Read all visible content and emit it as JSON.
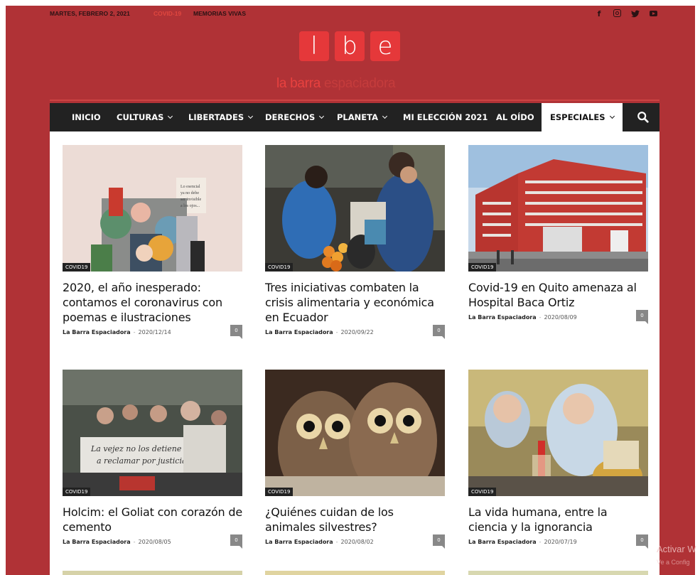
{
  "topbar": {
    "date": "MARTES, FEBRERO 2, 2021",
    "links": [
      "COVID-19",
      "MEMORIAS VIVAS"
    ],
    "social_icons": [
      "facebook-icon",
      "instagram-icon",
      "twitter-icon",
      "youtube-icon"
    ]
  },
  "logo": {
    "letters": [
      "l",
      "b",
      "e"
    ],
    "tagline_part1": "la barra",
    "tagline_part2": "espaciadora"
  },
  "nav": {
    "items": [
      {
        "label": "INICIO",
        "dropdown": false
      },
      {
        "label": "CULTURAS",
        "dropdown": true
      },
      {
        "label": "LIBERTADES",
        "dropdown": true
      },
      {
        "label": "DERECHOS",
        "dropdown": true
      },
      {
        "label": "PLANETA",
        "dropdown": true
      },
      {
        "label": "MI ELECCIÓN 2021",
        "dropdown": false
      },
      {
        "label": "AL OÍDO",
        "dropdown": false
      },
      {
        "label": "ESPECIALES",
        "dropdown": true,
        "active": true
      }
    ]
  },
  "cards": [
    {
      "category": "COVID19",
      "title": "2020, el año inesperado: contamos el coronavirus con poemas e ilustraciones",
      "author": "La Barra Espaciadora",
      "date": "2020/12/14",
      "comments": "0"
    },
    {
      "category": "COVID19",
      "title": "Tres iniciativas combaten la crisis alimentaria y económica en Ecuador",
      "author": "La Barra Espaciadora",
      "date": "2020/09/22",
      "comments": "0"
    },
    {
      "category": "COVID19",
      "title": "Covid-19 en Quito amenaza al Hospital Baca Ortiz",
      "author": "La Barra Espaciadora",
      "date": "2020/08/09",
      "comments": "0"
    },
    {
      "category": "COVID19",
      "title": "Holcim: el Goliat con corazón de cemento",
      "author": "La Barra Espaciadora",
      "date": "2020/08/05",
      "comments": "0"
    },
    {
      "category": "COVID19",
      "title": "¿Quiénes cuidan de los animales silvestres?",
      "author": "La Barra Espaciadora",
      "date": "2020/08/02",
      "comments": "0"
    },
    {
      "category": "COVID19",
      "title": "La vida humana, entre la ciencia y la ignorancia",
      "author": "La Barra Espaciadora",
      "date": "2020/07/19",
      "comments": "0"
    }
  ],
  "watermark": {
    "line1": "Activar W",
    "line2": "Ve a Config"
  },
  "colors": {
    "brand_red": "#b03236",
    "logo_red": "#e5383a",
    "nav_bg": "#222222"
  }
}
